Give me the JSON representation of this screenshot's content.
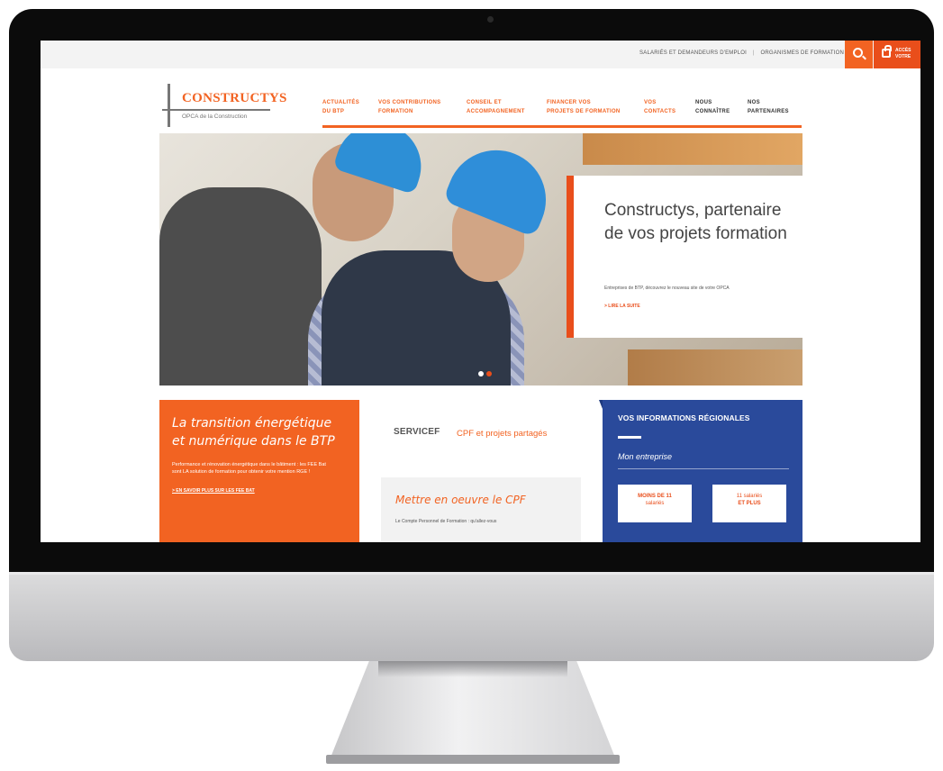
{
  "topbar": {
    "link1": "SALARIÉS ET DEMANDEURS D'EMPLOI",
    "separator": "|",
    "link2": "ORGANISMES DE FORMATION",
    "access_label_line1": "ACCÈS",
    "access_label_line2": "VOTRE"
  },
  "logo": {
    "name": "CONSTRUCTYS",
    "tagline": "OPCA de la Construction"
  },
  "nav": [
    {
      "line1": "ACTUALITÉS",
      "line2": "DU BTP"
    },
    {
      "line1": "VOS CONTRIBUTIONS",
      "line2": "FORMATION"
    },
    {
      "line1": "CONSEIL ET",
      "line2": "ACCOMPAGNEMENT"
    },
    {
      "line1": "FINANCER VOS",
      "line2": "PROJETS DE FORMATION"
    },
    {
      "line1": "VOS",
      "line2": "CONTACTS"
    },
    {
      "line1": "NOUS",
      "line2": "CONNAÎTRE"
    },
    {
      "line1": "NOS",
      "line2": "PARTENAIRES"
    }
  ],
  "hero": {
    "title": "Constructys, partenaire de vos projets formation",
    "text": "Entreprises de BTP, découvrez le nouveau site de votre OPCA",
    "link": "> LIRE LA SUITE"
  },
  "promo": {
    "title": "La transition énergétique et numérique dans le BTP",
    "text": "Performance et rénovation énergétique dans le bâtiment : les FEE Bat sont LA solution de formation pour obtenir votre mention RGE !",
    "link": "> EN SAVOIR PLUS SUR LES FEE BAT"
  },
  "service": {
    "logo": "SERVICEF",
    "logo_sub": "",
    "text": "CPF et projets partagés"
  },
  "cpf": {
    "title": "Mettre en oeuvre le CPF",
    "text": "Le Compte Personnel de Formation : qu'allez-vous"
  },
  "regional": {
    "title": "VOS INFORMATIONS RÉGIONALES",
    "subtitle": "Mon entreprise",
    "btn1_line1": "MOINS DE 11",
    "btn1_line2": "salariés",
    "btn2_line1": "11 salariés",
    "btn2_line2": "ET PLUS"
  }
}
